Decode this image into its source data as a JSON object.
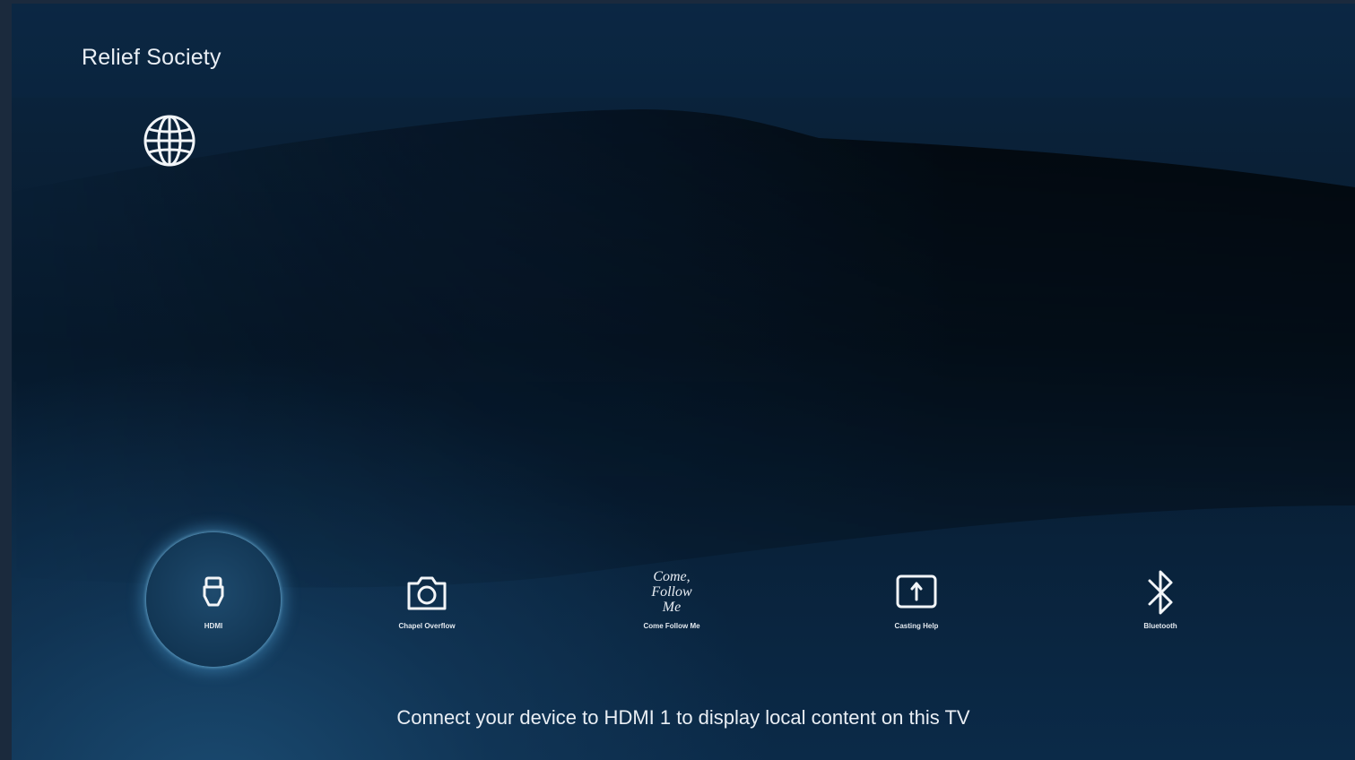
{
  "header": {
    "title": "Relief Society",
    "language_icon": "globe-icon"
  },
  "tiles": [
    {
      "label": "HDMI",
      "icon": "hdmi-icon",
      "selected": true
    },
    {
      "label": "Chapel Overflow",
      "icon": "camera-icon",
      "selected": false
    },
    {
      "label": "Come Follow Me",
      "icon": "come-follow-me-logo",
      "logo_line1": "Come,",
      "logo_line2": "Follow Me",
      "selected": false
    },
    {
      "label": "Casting Help",
      "icon": "cast-upload-icon",
      "selected": false
    },
    {
      "label": "Bluetooth",
      "icon": "bluetooth-icon",
      "selected": false
    }
  ],
  "footer": {
    "status_text": "Connect your device to HDMI 1 to display local content on this TV"
  },
  "colors": {
    "background_top": "#0b2743",
    "background_glow": "#1a4a70",
    "text": "#e9eef4",
    "selection_glow": "#50a0d2"
  }
}
